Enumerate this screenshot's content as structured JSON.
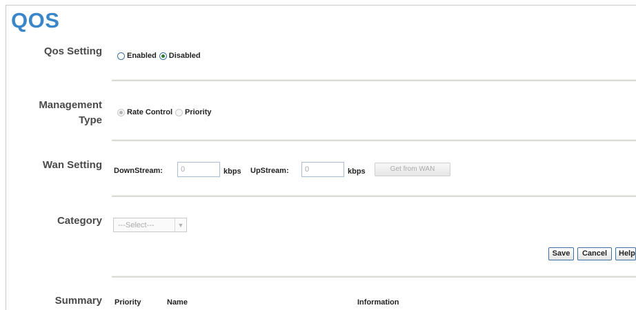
{
  "page": {
    "title": "QOS"
  },
  "qos_setting": {
    "label": "Qos Setting",
    "options": [
      {
        "label": "Enabled",
        "checked": false
      },
      {
        "label": "Disabled",
        "checked": true
      }
    ]
  },
  "management_type": {
    "label_line1": "Management",
    "label_line2": "Type",
    "options": [
      {
        "label": "Rate Control",
        "checked": true,
        "disabled": true
      },
      {
        "label": "Priority",
        "checked": false,
        "disabled": true
      }
    ]
  },
  "wan_setting": {
    "label": "Wan Setting",
    "downstream": {
      "label": "DownStream:",
      "value": "0",
      "unit": "kbps"
    },
    "upstream": {
      "label": "UpStream:",
      "value": "0",
      "unit": "kbps"
    },
    "get_from_wan_label": "Get from WAN"
  },
  "category": {
    "label": "Category",
    "selected": "---Select---"
  },
  "actions": {
    "save": "Save",
    "cancel": "Cancel",
    "help": "Help"
  },
  "summary": {
    "label": "Summary",
    "columns": [
      "Priority",
      "Name",
      "Information"
    ]
  }
}
